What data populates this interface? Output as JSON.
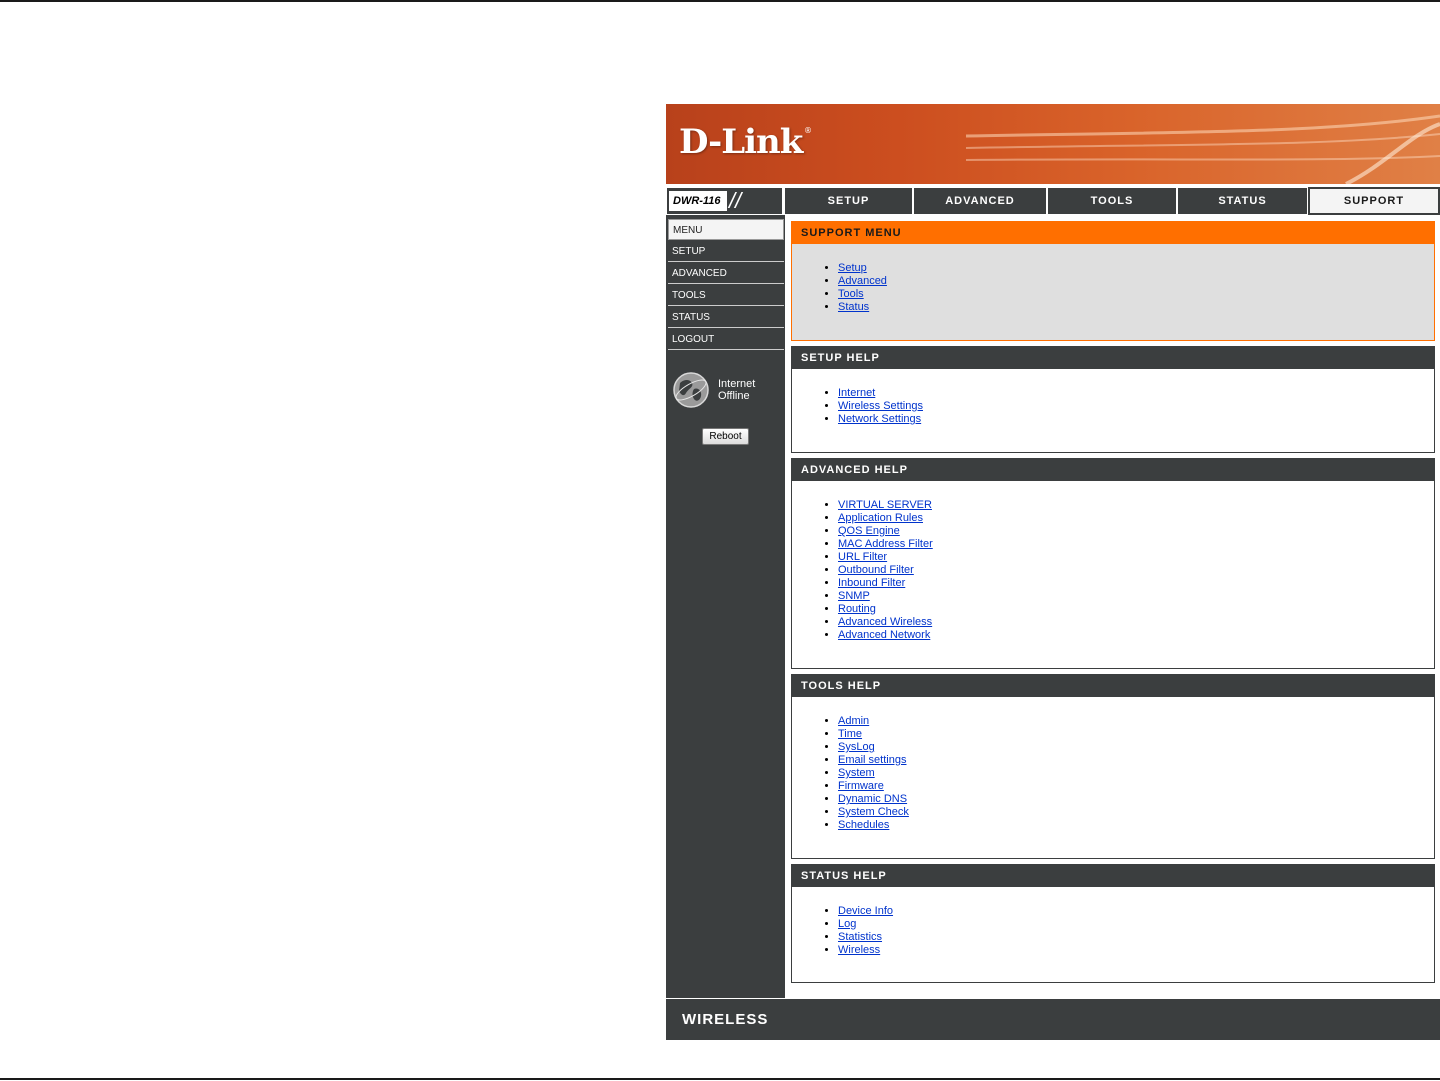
{
  "brand": {
    "logo_text": "D-Link",
    "registered": "®"
  },
  "model": {
    "label": "DWR-116",
    "slashes": "//"
  },
  "nav": {
    "tabs": [
      {
        "label": "SETUP"
      },
      {
        "label": "ADVANCED"
      },
      {
        "label": "TOOLS"
      },
      {
        "label": "STATUS"
      },
      {
        "label": "SUPPORT",
        "active": true
      }
    ]
  },
  "sidebar": {
    "items": [
      {
        "label": "MENU",
        "active": true
      },
      {
        "label": "SETUP"
      },
      {
        "label": "ADVANCED"
      },
      {
        "label": "TOOLS"
      },
      {
        "label": "STATUS"
      },
      {
        "label": "LOGOUT"
      }
    ],
    "status_line1": "Internet",
    "status_line2": "Offline",
    "status_icon": "globe-icon",
    "reboot_label": "Reboot"
  },
  "panels": [
    {
      "title": "SUPPORT MENU",
      "links": [
        "Setup",
        "Advanced",
        "Tools",
        "Status"
      ]
    },
    {
      "title": "SETUP HELP",
      "links": [
        "Internet",
        "Wireless Settings",
        "Network Settings"
      ]
    },
    {
      "title": "ADVANCED HELP",
      "links": [
        "VIRTUAL SERVER",
        "Application Rules",
        "QOS Engine",
        "MAC Address Filter",
        "URL Filter",
        "Outbound Filter",
        "Inbound Filter",
        "SNMP",
        "Routing",
        "Advanced Wireless",
        "Advanced Network"
      ]
    },
    {
      "title": "TOOLS HELP",
      "links": [
        "Admin",
        "Time",
        "SysLog",
        "Email settings",
        "System",
        "Firmware",
        "Dynamic DNS",
        "System Check",
        "Schedules"
      ]
    },
    {
      "title": "STATUS HELP",
      "links": [
        "Device Info",
        "Log",
        "Statistics",
        "Wireless"
      ]
    }
  ],
  "footer": {
    "label": "WIRELESS"
  },
  "colors": {
    "accent": "#ff6f00",
    "dark": "#3b3e3f",
    "link": "#0033cc",
    "banner": "#cc4e1f"
  }
}
